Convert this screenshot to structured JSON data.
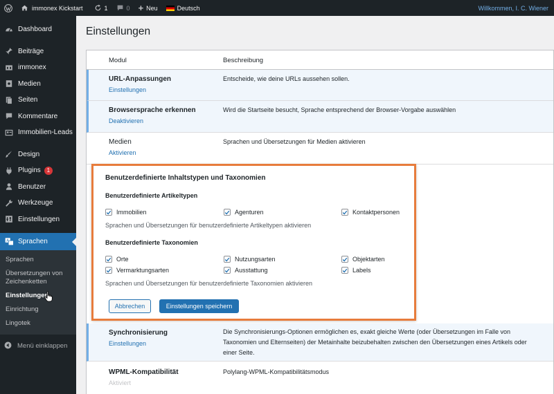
{
  "adminbar": {
    "site_name": "immonex Kickstart",
    "updates_count": "1",
    "comments_count": "0",
    "new_label": "Neu",
    "language_label": "Deutsch",
    "greeting": "Willkommen, I. C. Wiener"
  },
  "sidebar": {
    "items": [
      {
        "label": "Dashboard",
        "icon": "dashboard-icon"
      },
      {
        "label": "Beiträge",
        "icon": "pin-icon"
      },
      {
        "label": "immonex",
        "icon": "immonex-icon"
      },
      {
        "label": "Medien",
        "icon": "media-icon"
      },
      {
        "label": "Seiten",
        "icon": "pages-icon"
      },
      {
        "label": "Kommentare",
        "icon": "comments-icon"
      },
      {
        "label": "Immobilien-Leads",
        "icon": "leads-icon"
      },
      {
        "label": "Design",
        "icon": "brush-icon"
      },
      {
        "label": "Plugins",
        "icon": "plugins-icon",
        "badge": "1"
      },
      {
        "label": "Benutzer",
        "icon": "users-icon"
      },
      {
        "label": "Werkzeuge",
        "icon": "tools-icon"
      },
      {
        "label": "Einstellungen",
        "icon": "settings-icon"
      },
      {
        "label": "Sprachen",
        "icon": "languages-icon"
      }
    ],
    "submenu": [
      "Sprachen",
      "Übersetzungen von Zeichenketten",
      "Einstellungen",
      "Einrichtung",
      "Lingotek"
    ],
    "collapse_label": "Menü einklappen"
  },
  "page": {
    "title": "Einstellungen",
    "col_module": "Modul",
    "col_description": "Beschreibung"
  },
  "rows": {
    "url": {
      "name": "URL-Anpassungen",
      "action": "Einstellungen",
      "desc": "Entscheide, wie deine URLs aussehen sollen."
    },
    "browser": {
      "name": "Browsersprache erkennen",
      "action": "Deaktivieren",
      "desc": "Wird die Startseite besucht, Sprache entsprechend der Browser-Vorgabe auswählen"
    },
    "media": {
      "name": "Medien",
      "action": "Aktivieren",
      "desc": "Sprachen und Übersetzungen für Medien aktivieren"
    },
    "sync": {
      "name": "Synchronisierung",
      "action": "Einstellungen",
      "desc": "Die Synchronisierungs-Optionen ermöglichen es, exakt gleiche Werte (oder Übersetzungen im Falle von Taxonomien und Elternseiten) der Metainhalte beizubehalten zwischen den Übersetzungen eines Artikels oder einer Seite."
    },
    "wpml": {
      "name": "WPML-Kompatibilität",
      "action": "Aktiviert",
      "desc": "Polylang-WPML-Kompatibilitätsmodus"
    }
  },
  "panel": {
    "title": "Benutzerdefinierte Inhaltstypen und Taxonomien",
    "post_types_title": "Benutzerdefinierte Artikeltypen",
    "post_types": [
      "Immobilien",
      "Agenturen",
      "Kontaktpersonen"
    ],
    "post_types_note": "Sprachen und Übersetzungen für benutzerdefinierte Artikeltypen aktivieren",
    "taxonomies_title": "Benutzerdefinierte Taxonomien",
    "taxonomies": [
      "Orte",
      "Nutzungsarten",
      "Objektarten",
      "Vermarktungsarten",
      "Ausstattung",
      "Labels"
    ],
    "taxonomies_note": "Sprachen und Übersetzungen für benutzerdefinierte Taxonomien aktivieren",
    "cancel_label": "Abbrechen",
    "save_label": "Einstellungen speichern"
  },
  "colors": {
    "adminbar_bg": "#1d2327",
    "accent": "#2271b1",
    "highlight_border": "#e77c3c",
    "badge": "#d63638"
  }
}
